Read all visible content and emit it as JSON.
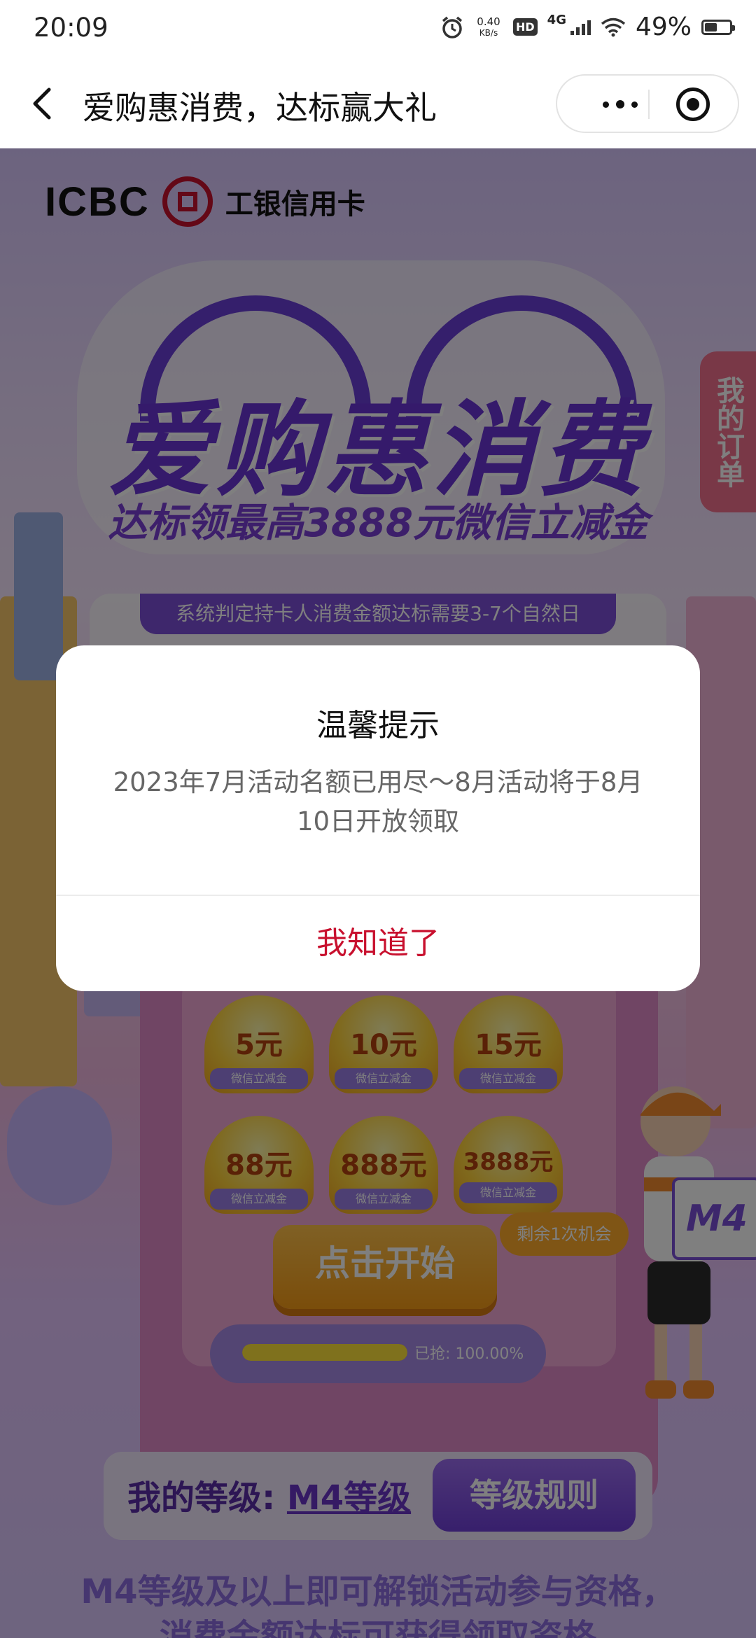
{
  "status_bar": {
    "time": "20:09",
    "net_speed_value": "0.40",
    "net_speed_unit": "KB/s",
    "hd_badge": "HD",
    "network_type": "4G",
    "battery_text": "49%",
    "battery_level_percent": 49,
    "icons": [
      "alarm-icon",
      "hd-icon",
      "signal-icon",
      "wifi-icon",
      "battery-icon"
    ]
  },
  "nav": {
    "title": "爱购惠消费，达标赢大礼",
    "back_icon": "chevron-left-icon",
    "more_icon": "more-dots-icon",
    "close_icon": "miniprogram-close-icon"
  },
  "page": {
    "logo_en": "ICBC",
    "logo_cn": "工银信用卡",
    "hero_title": "爱购惠消费",
    "hero_subtitle": "达标领最高3888元微信立减金",
    "order_tab": "我的订单",
    "notice": "系统判定持卡人消费金额达标需要3-7个自然日",
    "prizes": [
      {
        "amount": "5元",
        "caption": "微信立减金"
      },
      {
        "amount": "10元",
        "caption": "微信立减金"
      },
      {
        "amount": "15元",
        "caption": "微信立减金"
      },
      {
        "amount": "88元",
        "caption": "微信立减金"
      },
      {
        "amount": "888元",
        "caption": "微信立减金"
      },
      {
        "amount": "3888元",
        "caption": "微信立减金"
      }
    ],
    "start_button": "点击开始",
    "chance_badge": "剩余1次机会",
    "progress_label": "已抢: 100.00%",
    "progress_percent": 100,
    "m4_sign": "M4",
    "level_label": "我的等级: ",
    "level_value": "M4等级",
    "rules_button": "等级规则",
    "bottom_line1": "M4等级及以上即可解锁活动参与资格，",
    "bottom_line2": "消费金额达标可获得领取资格"
  },
  "dialog": {
    "title": "温馨提示",
    "message": "2023年7月活动名额已用尽～8月活动将于8月10日开放领取",
    "confirm_button": "我知道了"
  },
  "colors": {
    "brand_red": "#c8102e",
    "purple": "#6b35d6",
    "overlay": "rgba(0,0,0,0.5)"
  }
}
